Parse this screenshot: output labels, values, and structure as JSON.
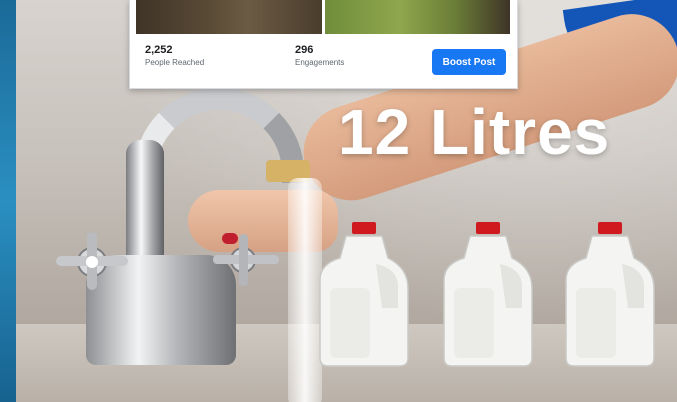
{
  "post_card": {
    "stats": [
      {
        "value": "2,252",
        "label": "People Reached"
      },
      {
        "value": "296",
        "label": "Engagements"
      }
    ],
    "boost_label": "Boost Post",
    "boost_color": "#1877f2"
  },
  "image": {
    "caption": "12 Litres",
    "jug_cap_color": "#d0181f"
  }
}
